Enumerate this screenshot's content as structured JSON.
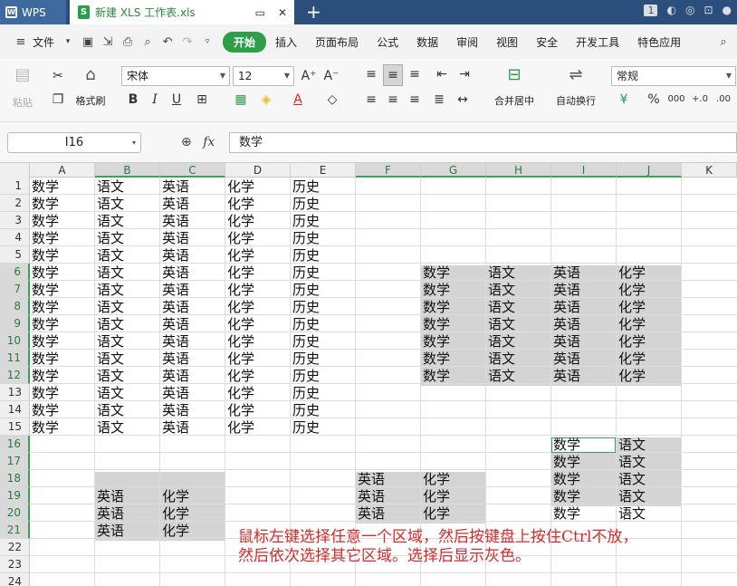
{
  "titlebar": {
    "app_tab": "WPS",
    "doc_tab": "新建 XLS 工作表.xls",
    "badge": "1"
  },
  "menu": {
    "file": "文件",
    "items": [
      "开始",
      "插入",
      "页面布局",
      "公式",
      "数据",
      "审阅",
      "视图",
      "安全",
      "开发工具",
      "特色应用"
    ]
  },
  "ribbon": {
    "paste": "粘贴",
    "format_painter": "格式刷",
    "font_name": "宋体",
    "font_size": "12",
    "merge_center": "合并居中",
    "wrap_text": "自动换行",
    "number_format": "常规"
  },
  "formula_bar": {
    "name_box": "I16",
    "fx": "fx",
    "content": "数学"
  },
  "columns": [
    "A",
    "B",
    "C",
    "D",
    "E",
    "F",
    "G",
    "H",
    "I",
    "J",
    "K"
  ],
  "highlight_columns": [
    "B",
    "C",
    "F",
    "G",
    "H",
    "I",
    "J"
  ],
  "rows": [
    "1",
    "2",
    "3",
    "4",
    "5",
    "6",
    "7",
    "8",
    "9",
    "10",
    "11",
    "12",
    "13",
    "14",
    "15",
    "16",
    "17",
    "18",
    "19",
    "20",
    "21",
    "22",
    "23",
    "24"
  ],
  "highlight_rows": [
    "6",
    "7",
    "8",
    "9",
    "10",
    "11",
    "12",
    "16",
    "17",
    "18",
    "19",
    "20",
    "21"
  ],
  "block_main_row": [
    "数学",
    "语文",
    "英语",
    "化学",
    "历史"
  ],
  "block_gh": [
    "数学",
    "语文",
    "英语",
    "化学"
  ],
  "block_ij": [
    "数学",
    "语文"
  ],
  "block_bc": [
    "英语",
    "化学"
  ],
  "block_fg": [
    "英语",
    "化学"
  ],
  "note": {
    "line1": "鼠标左键选择任意一个区域，然后按键盘上按住Ctrl不放，",
    "line2": "然后依次选择其它区域。选择后显示灰色。"
  }
}
